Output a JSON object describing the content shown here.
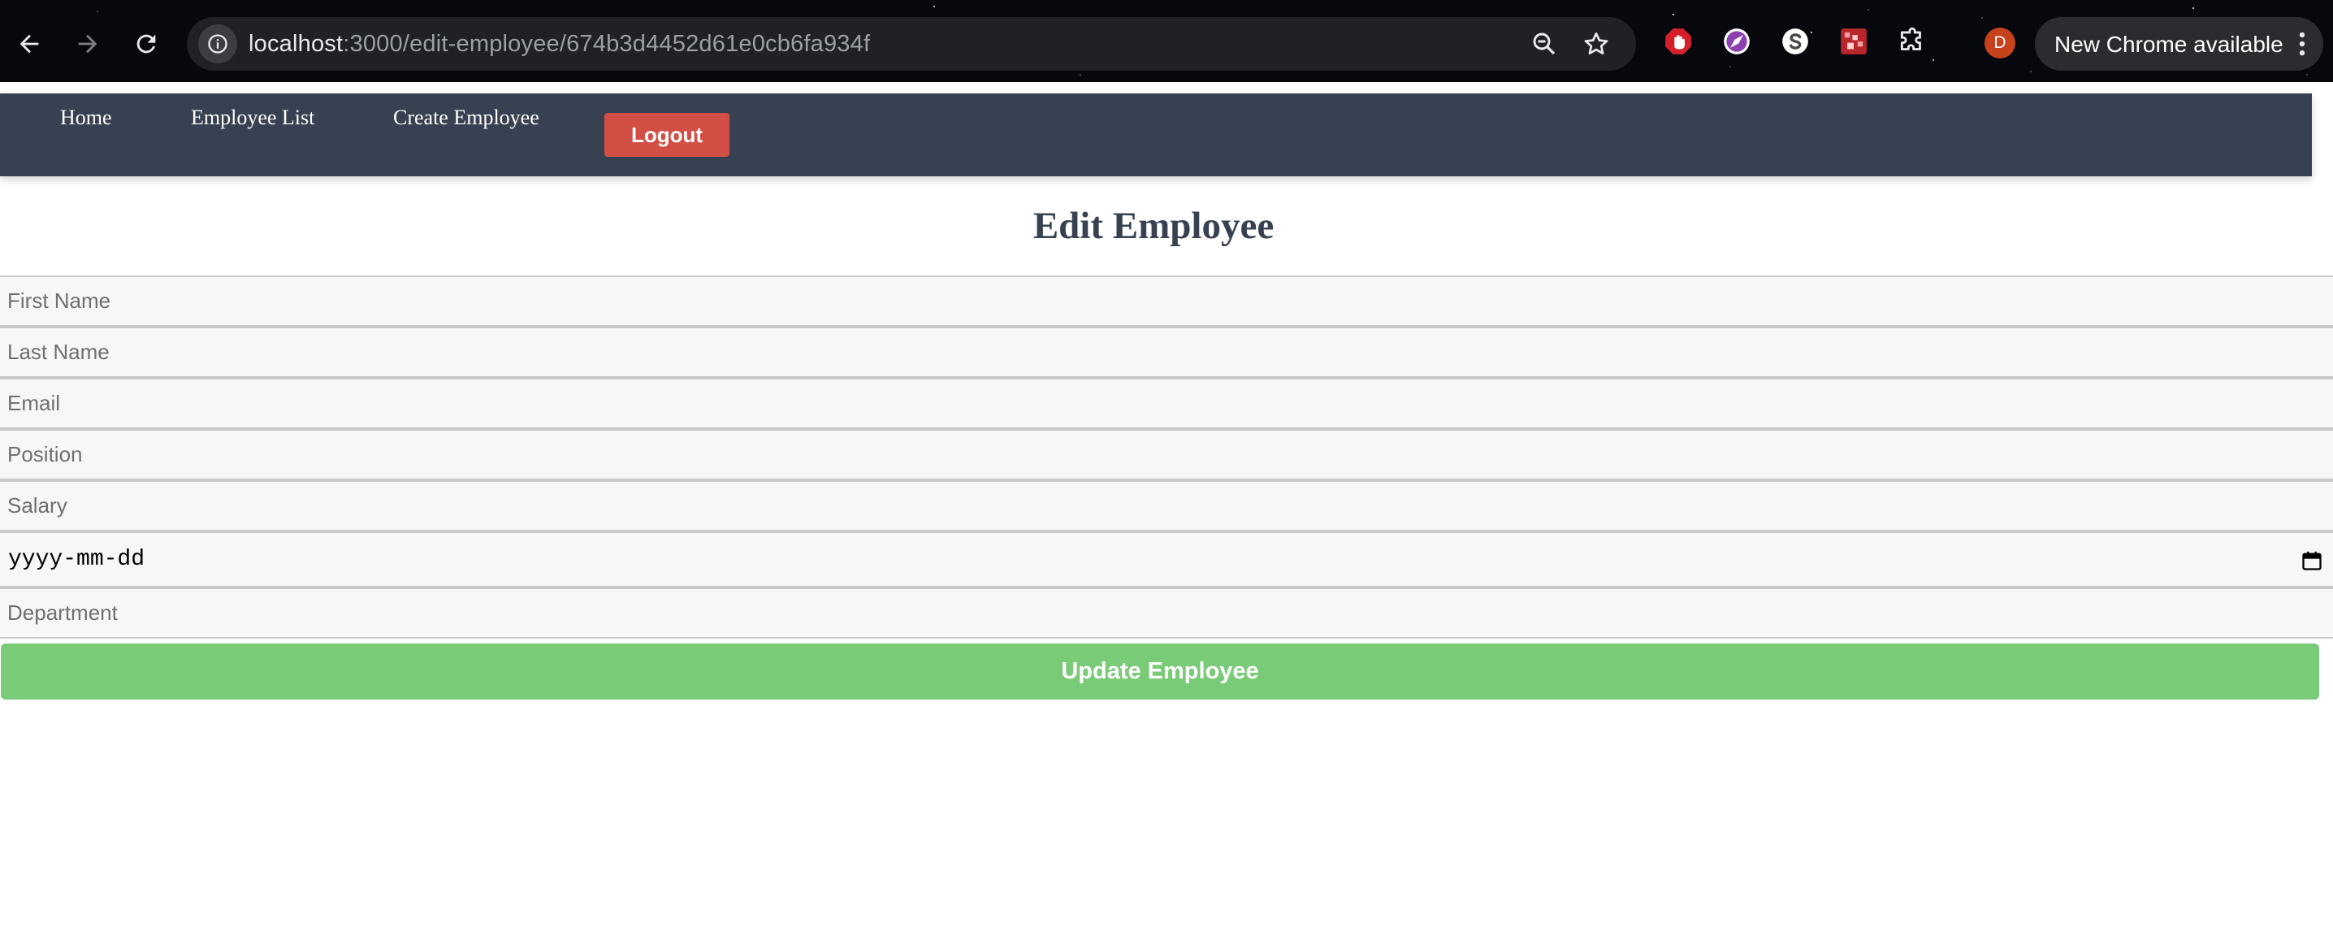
{
  "browser": {
    "url_host": "localhost",
    "url_path": ":3000/edit-employee/674b3d4452d61e0cb6fa934f",
    "update_label": "New Chrome available",
    "profile_initial": "D",
    "icons": {
      "back": "arrow-left-icon",
      "forward": "arrow-right-icon",
      "reload": "reload-icon",
      "site_info": "info-icon",
      "zoom": "zoom-icon",
      "bookmark": "star-icon",
      "extensions": "puzzle-icon",
      "menu": "more-vertical-icon"
    },
    "colors": {
      "profile_avatar": "#c5421c"
    }
  },
  "navbar": {
    "links": [
      {
        "label": "Home"
      },
      {
        "label": "Employee List"
      },
      {
        "label": "Create Employee"
      }
    ],
    "logout_label": "Logout",
    "colors": {
      "background": "#374151",
      "logout": "#d24f45"
    }
  },
  "page": {
    "title": "Edit Employee"
  },
  "form": {
    "first_name": {
      "placeholder": "First Name",
      "value": ""
    },
    "last_name": {
      "placeholder": "Last Name",
      "value": ""
    },
    "email": {
      "placeholder": "Email",
      "value": ""
    },
    "position": {
      "placeholder": "Position",
      "value": ""
    },
    "salary": {
      "placeholder": "Salary",
      "value": ""
    },
    "date": {
      "placeholder": "yyyy-mm-dd",
      "value": ""
    },
    "department": {
      "placeholder": "Department",
      "value": ""
    },
    "submit_label": "Update Employee",
    "colors": {
      "submit": "#7acb78"
    }
  }
}
